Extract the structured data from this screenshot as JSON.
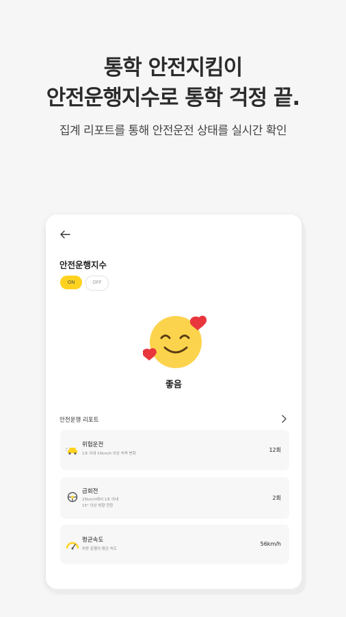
{
  "promo": {
    "headline_line1": "통학 안전지킴이",
    "headline_line2": "안전운행지수로 통학 걱정 끝.",
    "subtitle": "집계 리포트를 통해 안전운전 상태를 실시간 확인"
  },
  "screen": {
    "title": "안전운행지수",
    "toggle": {
      "on_label": "ON",
      "off_label": "OFF"
    },
    "status_label": "좋음",
    "report_section_label": "안전운행 리포트",
    "reports": [
      {
        "name": "위험운전",
        "desc": "1초 이내 15km/h 이상 속력 변화",
        "value": "12회",
        "icon": "car-speed-icon"
      },
      {
        "name": "급회전",
        "desc_line1": "25km/h에서 1초 이내",
        "desc_line2": "15° 이상 방향 전환",
        "value": "2회",
        "icon": "steering-icon"
      },
      {
        "name": "평균속도",
        "desc": "차량 운행의 평균 속도",
        "value": "56km/h",
        "icon": "speedometer-icon"
      }
    ]
  },
  "colors": {
    "accent": "#ffd21f",
    "heart": "#e8363c",
    "emoji": "#fcd34d"
  }
}
